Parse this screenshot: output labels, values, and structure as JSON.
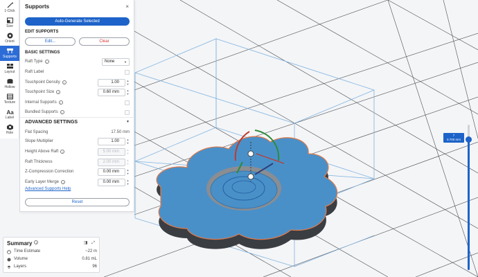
{
  "toolbar": {
    "items": [
      {
        "label": "1-Click",
        "icon": "magic-wand-icon"
      },
      {
        "label": "Size",
        "icon": "size-icon"
      },
      {
        "label": "Orient",
        "icon": "orient-icon"
      },
      {
        "label": "Supports",
        "icon": "supports-icon",
        "active": true
      },
      {
        "label": "Layout",
        "icon": "layout-icon"
      },
      {
        "label": "Hollow",
        "icon": "hollow-icon"
      },
      {
        "label": "Texture",
        "icon": "texture-icon"
      },
      {
        "label": "Label",
        "icon": "label-icon"
      },
      {
        "label": "Hole",
        "icon": "hole-icon"
      }
    ]
  },
  "panel": {
    "title": "Supports",
    "close": "×",
    "auto_generate": "Auto-Generate Selected",
    "edit_supports_title": "EDIT SUPPORTS",
    "edit_button": "Edit...",
    "clear_button": "Clear",
    "basic_settings_title": "BASIC SETTINGS",
    "basic": {
      "raft_type": {
        "label": "Raft Type",
        "value": "None"
      },
      "raft_label": {
        "label": "Raft Label"
      },
      "touchpoint_density": {
        "label": "Touchpoint Density",
        "value": "1.00"
      },
      "touchpoint_size": {
        "label": "Touchpoint Size",
        "value": "0.60 mm"
      },
      "internal_supports": {
        "label": "Internal Supports"
      },
      "bundled_supports": {
        "label": "Bundled Supports"
      }
    },
    "advanced_settings_title": "ADVANCED SETTINGS",
    "advanced": {
      "flat_spacing": {
        "label": "Flat Spacing",
        "value": "17.50 mm"
      },
      "slope_multiplier": {
        "label": "Slope Multiplier",
        "value": "1.00"
      },
      "height_above_raft": {
        "label": "Height Above Raft",
        "value": "5.00 mm"
      },
      "raft_thickness": {
        "label": "Raft Thickness",
        "value": "2.00 mm"
      },
      "z_compression": {
        "label": "Z-Compression Correction",
        "value": "0.00 mm"
      },
      "early_layer_merge": {
        "label": "Early Layer Merge",
        "value": "0.00 mm"
      }
    },
    "help_link": "Advanced Supports Help",
    "reset_button": "Reset"
  },
  "summary": {
    "title": "Summary",
    "rows": [
      {
        "label": "Time Estimate",
        "value": "~22 m",
        "icon": "clock-icon"
      },
      {
        "label": "Volume",
        "value": "0.81 mL",
        "icon": "volume-icon"
      },
      {
        "label": "Layers",
        "value": "96",
        "icon": "layers-icon"
      }
    ]
  },
  "layer_slider": {
    "layer": "7",
    "height": "0.700 mm",
    "level_fraction": 0.9
  },
  "colors": {
    "accent": "#1d63c9",
    "model": "#4a90c8",
    "bounding_box": "#7fb3e0"
  }
}
